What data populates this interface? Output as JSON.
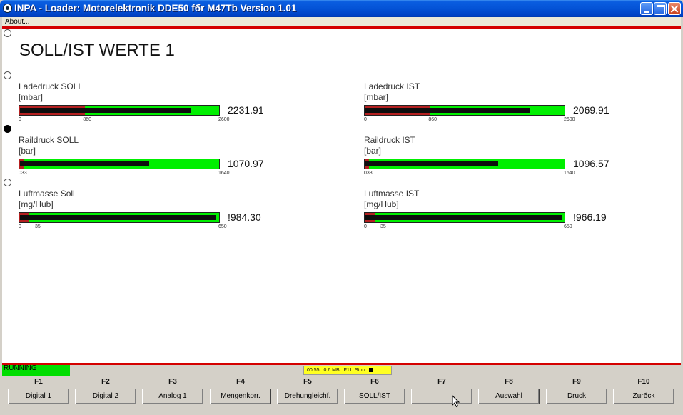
{
  "window": {
    "title": "INPA - Loader:  Motorelektronik DDE50 fбr M47Tb Version 1.01",
    "menu": [
      "About..."
    ]
  },
  "page": {
    "title": "SOLL/IST WERTE 1"
  },
  "gauges": [
    {
      "label": "Ladedruck SOLL",
      "unit": "[mbar]",
      "value": "2231.91",
      "scale_min": "0",
      "scale_mid": "860",
      "scale_max": "2600",
      "level": 0.86,
      "zone_end": 0.33
    },
    {
      "label": "Ladedruck IST",
      "unit": "[mbar]",
      "value": "2069.91",
      "scale_min": "0",
      "scale_mid": "860",
      "scale_max": "2600",
      "level": 0.83,
      "zone_end": 0.33
    },
    {
      "label": "Raildruck SOLL",
      "unit": "[bar]",
      "value": "1070.97",
      "scale_min": "033",
      "scale_mid": "",
      "scale_max": "1640",
      "level": 0.65,
      "zone_end": 0.02
    },
    {
      "label": "Raildruck IST",
      "unit": "[bar]",
      "value": "1096.57",
      "scale_min": "033",
      "scale_mid": "",
      "scale_max": "1640",
      "level": 0.67,
      "zone_end": 0.02
    },
    {
      "label": "Luftmasse Soll",
      "unit": "[mg/Hub]",
      "value": "!984.30",
      "scale_min": "0",
      "scale_mid": "35",
      "scale_max": "650",
      "level": 0.99,
      "zone_end": 0.05
    },
    {
      "label": "Luftmasse IST",
      "unit": "[mg/Hub]",
      "value": "!966.19",
      "scale_min": "0",
      "scale_mid": "35",
      "scale_max": "650",
      "level": 0.99,
      "zone_end": 0.05
    }
  ],
  "status": {
    "state": "RUNNING",
    "time": "00:55",
    "memory": "0.6 MB",
    "stop_hint": "F11: Stop"
  },
  "fkeys": [
    {
      "key": "F1",
      "label": "Digital 1"
    },
    {
      "key": "F2",
      "label": "Digital 2"
    },
    {
      "key": "F3",
      "label": "Analog 1"
    },
    {
      "key": "F4",
      "label": "Mengenkorr."
    },
    {
      "key": "F5",
      "label": "Drehungleichf."
    },
    {
      "key": "F6",
      "label": "SOLL/IST"
    },
    {
      "key": "F7",
      "label": ""
    },
    {
      "key": "F8",
      "label": "Auswahl"
    },
    {
      "key": "F9",
      "label": "Druck"
    },
    {
      "key": "F10",
      "label": "Zurбck"
    }
  ],
  "colors": {
    "accent_red": "#d40000",
    "gauge_green": "#00ef00",
    "gauge_red_zone": "#b42020",
    "running_green": "#00dd00",
    "status_yellow": "#ffff22"
  }
}
